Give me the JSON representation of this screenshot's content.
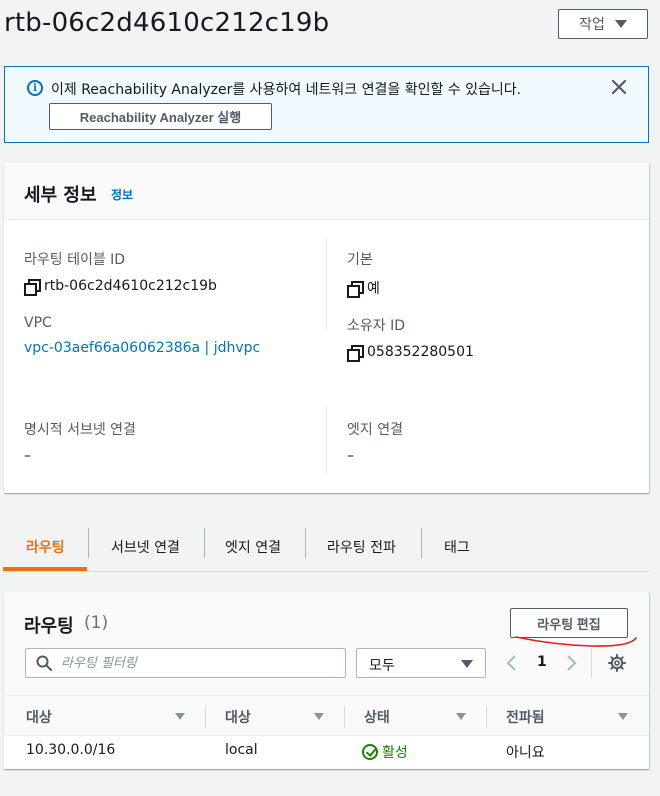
{
  "page": {
    "title": "rtb-06c2d4610c212c19b"
  },
  "actions": {
    "label": "작업"
  },
  "banner": {
    "text": "이제 Reachability Analyzer를 사용하여 네트워크 연결을 확인할 수 있습니다.",
    "button_label": "Reachability Analyzer 실행"
  },
  "details": {
    "title": "세부 정보",
    "info_link": "정보",
    "fields": [
      {
        "label": "라우팅 테이블 ID",
        "value": "rtb-06c2d4610c212c19b"
      },
      {
        "label": "기본",
        "value": "예"
      },
      {
        "label": "VPC",
        "value": "vpc-03aef66a06062386a | jdhvpc"
      },
      {
        "label": "소유자 ID",
        "value": "058352280501"
      },
      {
        "label": "명시적 서브넷 연결",
        "value": "–"
      },
      {
        "label": "엣지 연결",
        "value": "–"
      }
    ]
  },
  "tabs": [
    "라우팅",
    "서브넷 연결",
    "엣지 연결",
    "라우팅 전파",
    "태그"
  ],
  "routes": {
    "title": "라우팅",
    "count": "(1)",
    "edit_button": "라우팅 편집",
    "filter_placeholder": "라우팅 필터링",
    "select_value": "모두",
    "page": "1",
    "columns": [
      "대상",
      "대상",
      "상태",
      "전파됨"
    ],
    "rows": [
      {
        "destination": "10.30.0.0/16",
        "target": "local",
        "status": "활성",
        "propagated": "아니요"
      }
    ]
  },
  "colors": {
    "accent_orange": "#ec7211",
    "link_blue": "#0073bb",
    "success_green": "#1d8102",
    "annotation_red": "#e02020"
  }
}
